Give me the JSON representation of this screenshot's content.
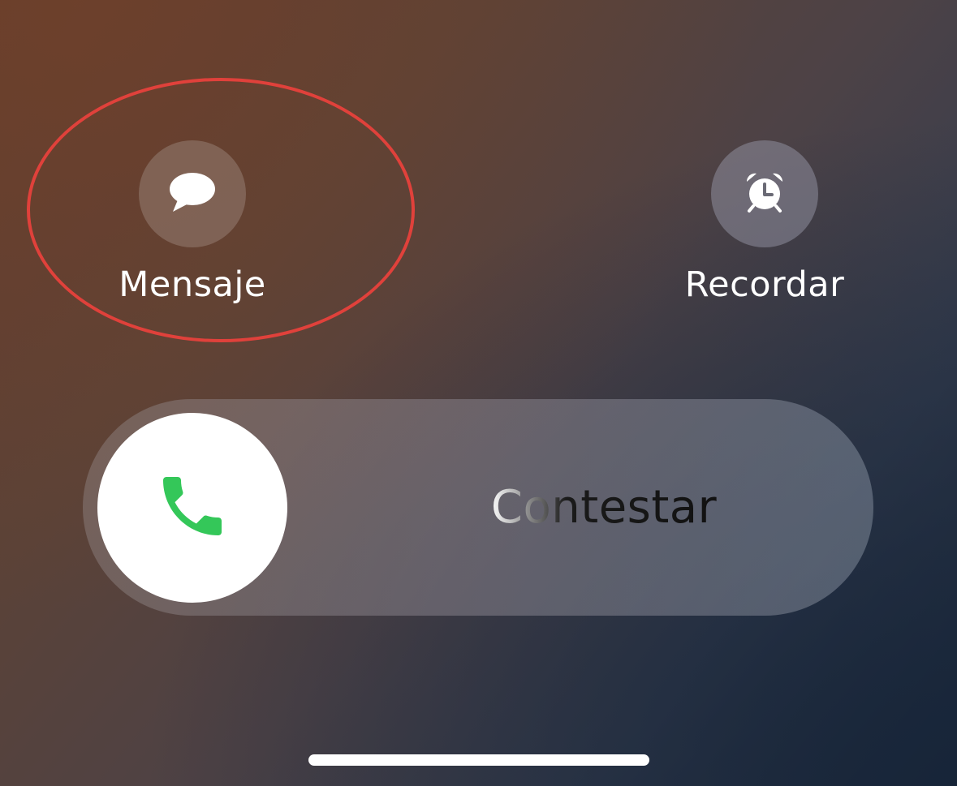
{
  "actions": {
    "message": {
      "label": "Mensaje",
      "icon": "message-bubble-icon"
    },
    "remind": {
      "label": "Recordar",
      "icon": "alarm-clock-icon"
    }
  },
  "answer_slider": {
    "label": "Contestar",
    "knob_icon": "phone-icon",
    "accent_color": "#34c759"
  },
  "highlight_color": "#e0413b"
}
